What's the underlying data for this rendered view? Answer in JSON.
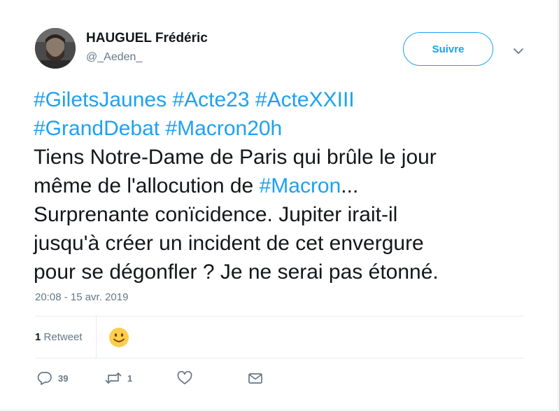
{
  "author": {
    "name": "HAUGUEL Frédéric",
    "handle": "@_Aeden_"
  },
  "follow_button": "Suivre",
  "tweet": {
    "lines": [
      [
        {
          "t": "#GiletsJaunes",
          "tag": true
        },
        {
          "t": " ",
          "tag": false
        },
        {
          "t": "#Acte23",
          "tag": true
        },
        {
          "t": " ",
          "tag": false
        },
        {
          "t": "#ActeXXIII",
          "tag": true
        }
      ],
      [
        {
          "t": "#GrandDebat",
          "tag": true
        },
        {
          "t": " ",
          "tag": false
        },
        {
          "t": "#Macron20h",
          "tag": true
        }
      ],
      [
        {
          "t": "Tiens Notre-Dame de Paris qui brûle le jour",
          "tag": false
        }
      ],
      [
        {
          "t": "même de l'allocution de ",
          "tag": false
        },
        {
          "t": "#Macron",
          "tag": true
        },
        {
          "t": "...",
          "tag": false
        }
      ],
      [
        {
          "t": "Surprenante conïcidence. Jupiter irait-il",
          "tag": false
        }
      ],
      [
        {
          "t": "jusqu'à créer un incident de cet envergure",
          "tag": false
        }
      ],
      [
        {
          "t": "pour se dégonfler ? Je ne serai pas étonné.",
          "tag": false
        }
      ]
    ]
  },
  "timestamp": "20:08 - 15 avr. 2019",
  "stats": {
    "retweet_count": "1",
    "retweet_label": "Retweet"
  },
  "actions": {
    "reply_count": "39",
    "retweet_count": "1",
    "like_count": "",
    "icons": [
      "reply-icon",
      "retweet-icon",
      "like-icon",
      "dm-icon"
    ]
  },
  "colors": {
    "link": "#1da1f2",
    "text": "#14171a",
    "muted": "#657786",
    "border": "#e6ecf0"
  }
}
